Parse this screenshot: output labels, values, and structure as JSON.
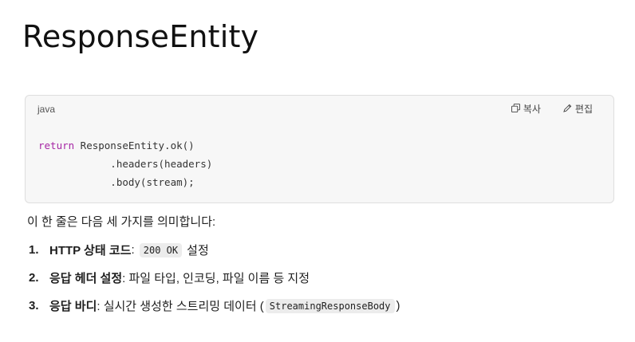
{
  "page_title": "ResponseEntity",
  "code_block": {
    "language": "java",
    "copy_label": "복사",
    "edit_label": "편집",
    "lines": [
      {
        "keyword": "return",
        "text": " ResponseEntity.ok()"
      },
      {
        "keyword": "",
        "text": "            .headers(headers)"
      },
      {
        "keyword": "",
        "text": "            .body(stream);"
      }
    ]
  },
  "intro": "이 한 줄은 다음 세 가지를 의미합니다:",
  "points": [
    {
      "num": "1.",
      "label": "HTTP 상태 코드",
      "pre": ": ",
      "code": "200 OK",
      "post": "설정"
    },
    {
      "num": "2.",
      "label": "응답 헤더 설정",
      "pre": ": 파일 타입, 인코딩, 파일 이름 등 지정",
      "code": "",
      "post": ""
    },
    {
      "num": "3.",
      "label": "응답 바디",
      "pre": ": 실시간 생성한 스트리밍 데이터 (",
      "code": "StreamingResponseBody",
      "post": ")"
    }
  ],
  "icons": {
    "copy": "copy-icon",
    "edit": "edit-icon"
  }
}
